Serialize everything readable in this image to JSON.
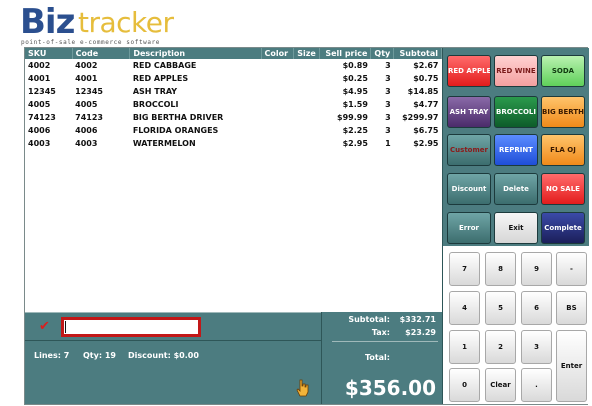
{
  "logo": {
    "brand_a": "Biz",
    "brand_b": "tracker",
    "tagline": "point-of-sale e-commerce software"
  },
  "table": {
    "headers": {
      "sku": "SKU",
      "code": "Code",
      "description": "Description",
      "color": "Color",
      "size": "Size",
      "price": "Sell price",
      "qty": "Qty",
      "subtotal": "Subtotal"
    },
    "rows": [
      {
        "sku": "4002",
        "code": "4002",
        "description": "RED CABBAGE",
        "color": "",
        "size": "",
        "price": "$0.89",
        "qty": "3",
        "subtotal": "$2.67"
      },
      {
        "sku": "4001",
        "code": "4001",
        "description": "RED APPLES",
        "color": "",
        "size": "",
        "price": "$0.25",
        "qty": "3",
        "subtotal": "$0.75"
      },
      {
        "sku": "12345",
        "code": "12345",
        "description": "ASH TRAY",
        "color": "",
        "size": "",
        "price": "$4.95",
        "qty": "3",
        "subtotal": "$14.85"
      },
      {
        "sku": "4005",
        "code": "4005",
        "description": "BROCCOLI",
        "color": "",
        "size": "",
        "price": "$1.59",
        "qty": "3",
        "subtotal": "$4.77"
      },
      {
        "sku": "74123",
        "code": "74123",
        "description": "BIG BERTHA DRIVER",
        "color": "",
        "size": "",
        "price": "$99.99",
        "qty": "3",
        "subtotal": "$299.97"
      },
      {
        "sku": "4006",
        "code": "4006",
        "description": "FLORIDA ORANGES",
        "color": "",
        "size": "",
        "price": "$2.25",
        "qty": "3",
        "subtotal": "$6.75"
      },
      {
        "sku": "4003",
        "code": "4003",
        "description": "WATERMELON",
        "color": "",
        "size": "",
        "price": "$2.95",
        "qty": "1",
        "subtotal": "$2.95"
      }
    ]
  },
  "entry": {
    "value": ""
  },
  "status": {
    "lines": "Lines: 7",
    "qty": "Qty: 19",
    "discount": "Discount: $0.00"
  },
  "totals": {
    "subtotal_label": "Subtotal:",
    "subtotal_value": "$332.71",
    "tax_label": "Tax:",
    "tax_value": "$23.29",
    "total_label": "Total:",
    "total_value": "$356.00"
  },
  "buttons": {
    "red_apple": "RED APPLE",
    "red_wine": "RED WINE",
    "soda": "SODA",
    "ash_tray": "ASH TRAY",
    "broccoli": "BROCCOLI",
    "big_bertha": "BIG BERTHA",
    "customer": "Customer",
    "reprint": "REPRINT",
    "fla_oj": "FLA OJ",
    "discount": "Discount",
    "delete": "Delete",
    "no_sale": "NO SALE",
    "error": "Error",
    "exit": "Exit",
    "complete": "Complete"
  },
  "keypad": {
    "k7": "7",
    "k8": "8",
    "k9": "9",
    "minus": "-",
    "k4": "4",
    "k5": "5",
    "k6": "6",
    "bs": "BS",
    "k1": "1",
    "k2": "2",
    "k3": "3",
    "enter": "Enter",
    "k0": "0",
    "clear": "Clear",
    "dot": "."
  },
  "colors": {
    "panel_teal": "#4c7c80",
    "accent_red": "#c21818",
    "brand_blue": "#2b4f8f",
    "brand_gold": "#e6bd3c"
  }
}
